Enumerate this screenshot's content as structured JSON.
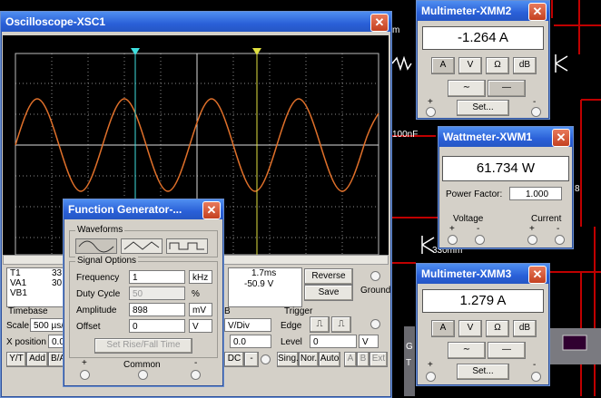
{
  "oscilloscope": {
    "title": "Oscilloscope-XSC1",
    "cursor_t1": "T1",
    "cursor_va1": "VA1",
    "cursor_vb1": "VB1",
    "t1_time": "33.",
    "va1_value": "30.",
    "t2_time": "1.7ms",
    "t2_minus_t1": "-50.9 V",
    "reverse_label": "Reverse",
    "save_label": "Save",
    "ground_label": "Ground",
    "timebase_label": "Timebase",
    "scale_label": "Scale",
    "scale_value": "500 µs/",
    "xpos_label": "X position",
    "xpos_value": "0.0",
    "yt_label": "Y/T",
    "add_label": "Add",
    "ba_label": "B/A",
    "channel_b_label": "B",
    "vdiv_label": "V/Div",
    "ypos_value": "0.0",
    "dc_label": "DC",
    "minus_label": "-",
    "trigger_label": "Trigger",
    "edge_label": "Edge",
    "level_label": "Level",
    "level_value": "0",
    "level_unit": "V",
    "sing_label": "Sing.",
    "nor_label": "Nor.",
    "auto_label": "Auto",
    "a_label": "A",
    "b_label": "B",
    "ext_label": "Ext"
  },
  "function_generator": {
    "title": "Function Generator-...",
    "waveforms_label": "Waveforms",
    "signal_options_label": "Signal Options",
    "frequency_label": "Frequency",
    "frequency_value": "1",
    "frequency_unit": "kHz",
    "duty_label": "Duty Cycle",
    "duty_value": "50",
    "duty_unit": "%",
    "amplitude_label": "Amplitude",
    "amplitude_value": "898",
    "amplitude_unit": "mV",
    "offset_label": "Offset",
    "offset_value": "0",
    "offset_unit": "V",
    "set_rise_label": "Set Rise/Fall Time",
    "plus_label": "+",
    "common_label": "Common",
    "minus_label": "-"
  },
  "multimeter2": {
    "title": "Multimeter-XMM2",
    "reading": "-1.264  A",
    "btn_a": "A",
    "btn_v": "V",
    "btn_ohm": "Ω",
    "btn_db": "dB",
    "set_label": "Set...",
    "plus_label": "+",
    "minus_label": "-"
  },
  "wattmeter": {
    "title": "Wattmeter-XWM1",
    "reading": "61.734 W",
    "pf_label": "Power Factor:",
    "pf_value": "1.000",
    "voltage_label": "Voltage",
    "current_label": "Current",
    "plus1": "+",
    "minus1": "-",
    "plus2": "+",
    "minus2": "-"
  },
  "multimeter3": {
    "title": "Multimeter-XMM3",
    "reading": "1.279  A",
    "btn_a": "A",
    "btn_v": "V",
    "btn_ohm": "Ω",
    "btn_db": "dB",
    "set_label": "Set...",
    "plus_label": "+",
    "minus_label": "-"
  },
  "background": {
    "cap_label": "100nF",
    "res_label": "330mm",
    "side_h": "m",
    "side_8": "8",
    "side_g": "G",
    "side_t": "T"
  }
}
